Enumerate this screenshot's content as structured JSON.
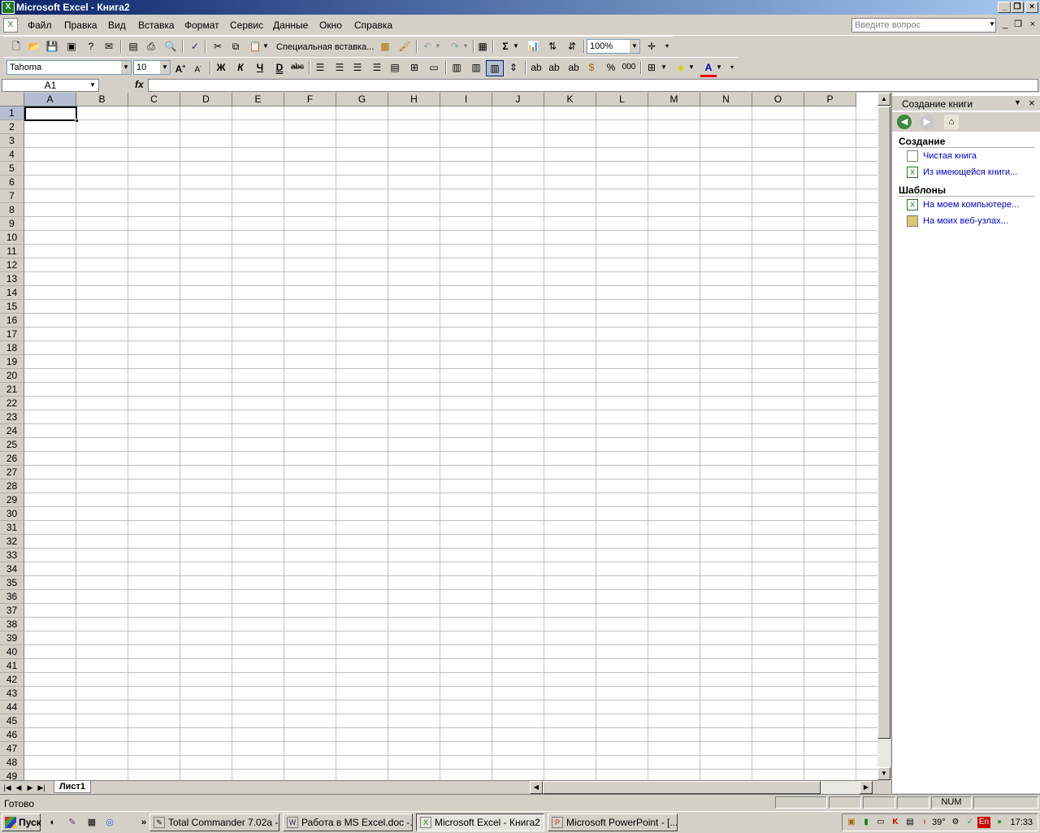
{
  "window": {
    "title": "Microsoft Excel - Книга2"
  },
  "menu": {
    "items": [
      "Файл",
      "Правка",
      "Вид",
      "Вставка",
      "Формат",
      "Сервис",
      "Данные",
      "Окно",
      "Справка"
    ],
    "ask_placeholder": "Введите вопрос"
  },
  "standard_toolbar": {
    "paste_special_label": "Специальная вставка...",
    "zoom": "100%"
  },
  "formatting_toolbar": {
    "font": "Tahoma",
    "size": "10",
    "bold": "Ж",
    "italic": "К",
    "underline": "Ч",
    "double_underline": "D",
    "strikethrough": "abc",
    "percent": "%",
    "thousands": "000"
  },
  "formula_bar": {
    "name_box": "A1",
    "fx": "fx",
    "value": ""
  },
  "sheet": {
    "columns": [
      "A",
      "B",
      "C",
      "D",
      "E",
      "F",
      "G",
      "H",
      "I",
      "J",
      "K",
      "L",
      "M",
      "N",
      "O",
      "P"
    ],
    "rows": [
      "1",
      "2",
      "3",
      "4",
      "5",
      "6",
      "7",
      "8",
      "9",
      "10",
      "11",
      "12",
      "13",
      "14",
      "15",
      "16",
      "17",
      "18",
      "19",
      "20",
      "21",
      "22",
      "23",
      "24",
      "25",
      "26",
      "27",
      "28",
      "29",
      "30",
      "31",
      "32",
      "33",
      "34",
      "35",
      "36",
      "37",
      "38",
      "39",
      "40",
      "41",
      "42",
      "43",
      "44",
      "45",
      "46",
      "47",
      "48",
      "49"
    ],
    "active_cell": "A1",
    "tabs": [
      "Лист1"
    ]
  },
  "task_pane": {
    "title": "Создание книги",
    "section_create": "Создание",
    "link_blank": "Чистая книга",
    "link_existing": "Из имеющейся книги...",
    "section_templates": "Шаблоны",
    "link_computer": "На моем компьютере...",
    "link_web": "На моих веб-узлах..."
  },
  "status_bar": {
    "text": "Готово",
    "num": "NUM"
  },
  "taskbar": {
    "start": "Пуск",
    "buttons": [
      "Total Commander 7.02a -...",
      "Работа в MS Excel.doc -...",
      "Microsoft Excel - Книга2",
      "Microsoft PowerPoint - [..."
    ],
    "temp": "39°",
    "lang": "En",
    "clock": "17:33"
  }
}
